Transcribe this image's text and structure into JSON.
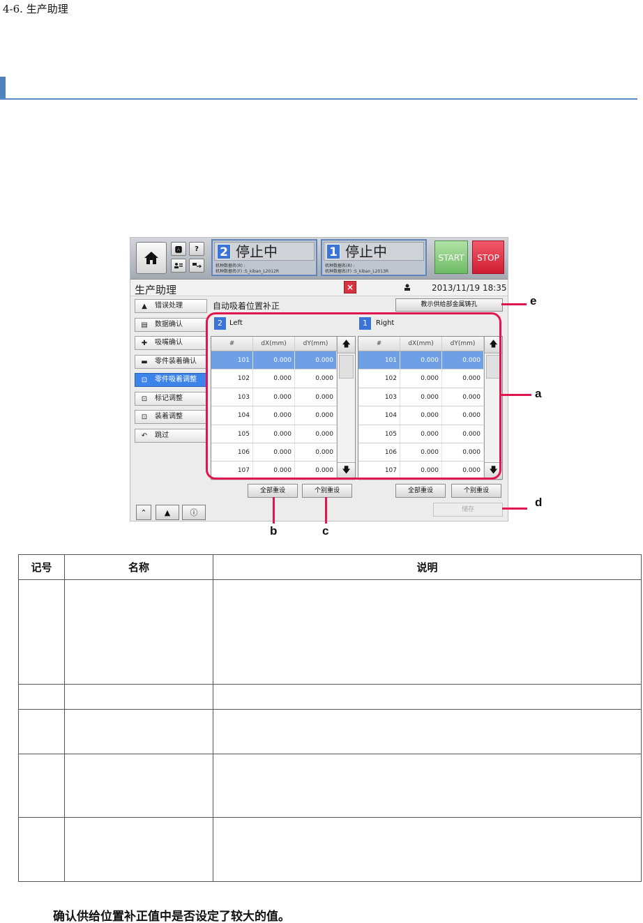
{
  "doc": {
    "section_number": "4-6. 生产助理",
    "note": "确认供给位置补正值中是否设定了较大的值。"
  },
  "ui": {
    "status_panels": [
      {
        "num": "2",
        "text": "停止中",
        "sub1": "机种数据名(R) :",
        "sub2": "机种数据名(F) :S_kiban_L2012R"
      },
      {
        "num": "1",
        "text": "停止中",
        "sub1": "机种数据名(R) :",
        "sub2": "机种数据名(F) :S_kiban_L2013R"
      }
    ],
    "start_label": "START",
    "stop_label": "STOP",
    "title": "生产助理",
    "close_label": "×",
    "datetime": "2013/11/19 18:35",
    "sidebar": [
      {
        "label": "错误处理",
        "icon": "warning-person-icon"
      },
      {
        "label": "数据确认",
        "icon": "data-check-icon"
      },
      {
        "label": "吸嘴确认",
        "icon": "nozzle-icon"
      },
      {
        "label": "零件装着确认",
        "icon": "part-mount-icon"
      },
      {
        "label": "零件吸着调整",
        "icon": "pickup-adjust-icon",
        "active": true
      },
      {
        "label": "标记调整",
        "icon": "mark-adjust-icon"
      },
      {
        "label": "装着调整",
        "icon": "mount-adjust-icon"
      },
      {
        "label": "跳过",
        "icon": "skip-icon"
      }
    ],
    "content_title": "自动吸着位置补正",
    "teach_button": "教示供给部金属铸孔",
    "columns": [
      "#",
      "dX(mm)",
      "dY(mm)"
    ],
    "left": {
      "badge": "2",
      "name": "Left",
      "rows": [
        [
          "101",
          "0.000",
          "0.000"
        ],
        [
          "102",
          "0.000",
          "0.000"
        ],
        [
          "103",
          "0.000",
          "0.000"
        ],
        [
          "104",
          "0.000",
          "0.000"
        ],
        [
          "105",
          "0.000",
          "0.000"
        ],
        [
          "106",
          "0.000",
          "0.000"
        ],
        [
          "107",
          "0.000",
          "0.000"
        ]
      ],
      "reset_all": "全部重设",
      "reset_single": "个别重设"
    },
    "right": {
      "badge": "1",
      "name": "Right",
      "rows": [
        [
          "101",
          "0.000",
          "0.000"
        ],
        [
          "102",
          "0.000",
          "0.000"
        ],
        [
          "103",
          "0.000",
          "0.000"
        ],
        [
          "104",
          "0.000",
          "0.000"
        ],
        [
          "105",
          "0.000",
          "0.000"
        ],
        [
          "106",
          "0.000",
          "0.000"
        ],
        [
          "107",
          "0.000",
          "0.000"
        ]
      ],
      "reset_all": "全部重设",
      "reset_single": "个别重设"
    },
    "save_button": "储存",
    "accent_color": "#3a74d8",
    "callout_color": "#e1154f"
  },
  "callouts": {
    "a": "a",
    "b": "b",
    "c": "c",
    "d": "d",
    "e": "e"
  },
  "desc_table": {
    "headers": [
      "记号",
      "名称",
      "说明"
    ]
  }
}
